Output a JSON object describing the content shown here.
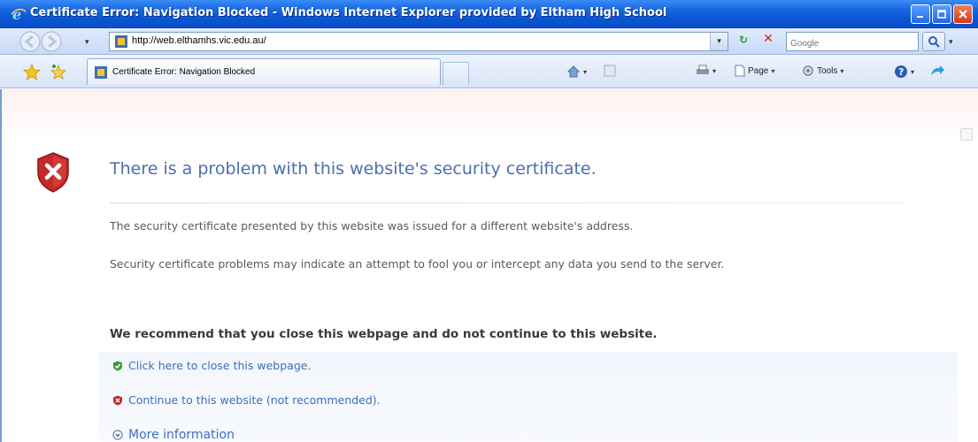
{
  "window": {
    "title": "Certificate Error: Navigation Blocked - Windows Internet Explorer provided by Eltham High School"
  },
  "address_bar": {
    "url": "http://web.elthamhs.vic.edu.au/",
    "search_placeholder": "Google"
  },
  "tab": {
    "label": "Certificate Error: Navigation Blocked"
  },
  "command_bar": {
    "page_label": "Page",
    "tools_label": "Tools"
  },
  "content": {
    "heading": "There is a problem with this website's security certificate.",
    "paragraph_1": "The security certificate presented by this website was issued for a different website's address.",
    "paragraph_2": "Security certificate problems may indicate an attempt to fool you or intercept any data you send to the server.",
    "recommendation": "We recommend that you close this webpage and do not continue to this website.",
    "options": {
      "close_link": "Click here to close this webpage.",
      "continue_link": "Continue to this website (not recommended).",
      "more_info": "More information"
    }
  },
  "colors": {
    "title_bar": "#0a55d6",
    "heading": "#4a6faf",
    "link": "#3b6fbf",
    "error_red": "#c42a2a",
    "ok_green": "#3a9a3a"
  }
}
